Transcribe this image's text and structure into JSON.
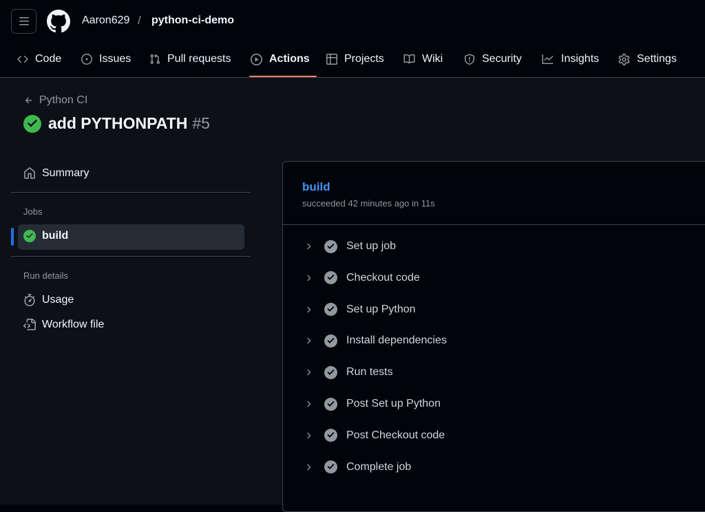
{
  "header": {
    "owner": "Aaron629",
    "separator": "/",
    "repo": "python-ci-demo"
  },
  "tabs": [
    {
      "label": "Code",
      "icon": "code-icon"
    },
    {
      "label": "Issues",
      "icon": "issue-icon"
    },
    {
      "label": "Pull requests",
      "icon": "pull-request-icon"
    },
    {
      "label": "Actions",
      "icon": "play-icon",
      "active": true
    },
    {
      "label": "Projects",
      "icon": "table-icon"
    },
    {
      "label": "Wiki",
      "icon": "book-icon"
    },
    {
      "label": "Security",
      "icon": "shield-icon"
    },
    {
      "label": "Insights",
      "icon": "graph-icon"
    },
    {
      "label": "Settings",
      "icon": "gear-icon"
    }
  ],
  "run": {
    "workflow_name": "Python CI",
    "title": "add PYTHONPATH",
    "number": "#5",
    "status": "success"
  },
  "sidebar": {
    "summary_label": "Summary",
    "jobs_heading": "Jobs",
    "jobs": [
      {
        "label": "build",
        "status": "success"
      }
    ],
    "run_details_heading": "Run details",
    "details": [
      {
        "label": "Usage",
        "icon": "stopwatch-icon"
      },
      {
        "label": "Workflow file",
        "icon": "file-code-icon"
      }
    ]
  },
  "job_panel": {
    "title": "build",
    "subtitle": "succeeded 42 minutes ago in 11s",
    "steps": [
      {
        "label": "Set up job"
      },
      {
        "label": "Checkout code"
      },
      {
        "label": "Set up Python"
      },
      {
        "label": "Install dependencies"
      },
      {
        "label": "Run tests"
      },
      {
        "label": "Post Set up Python"
      },
      {
        "label": "Post Checkout code"
      },
      {
        "label": "Complete job"
      }
    ]
  },
  "colors": {
    "accent": "#4493f8",
    "success": "#3fb950",
    "active_tab_underline": "#f78166",
    "background": "#0d1117"
  }
}
